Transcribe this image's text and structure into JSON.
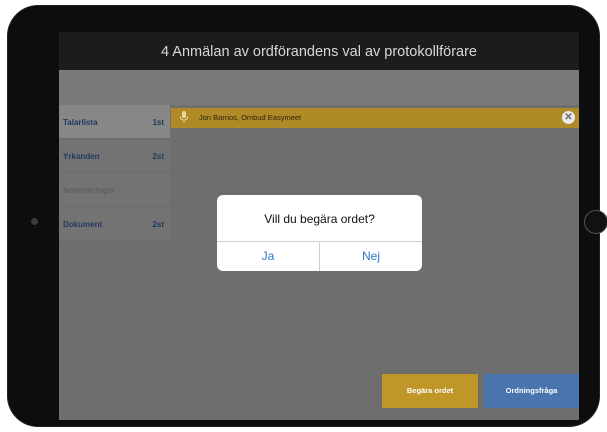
{
  "header": {
    "title": "4 Anmälan av ordförandens val av protokollförare"
  },
  "sidebar": {
    "items": [
      {
        "label": "Talarlista",
        "count": "1st"
      },
      {
        "label": "Yrkanden",
        "count": "2st"
      },
      {
        "label": "Nomineringar",
        "count": ""
      },
      {
        "label": "Dokument",
        "count": "2st"
      }
    ]
  },
  "speaker": {
    "name": "Jon Barrios, Ombud Easymeet",
    "icon": "microphone-icon",
    "close_icon": "close-icon"
  },
  "dialog": {
    "message": "Vill du begära ordet?",
    "yes": "Ja",
    "no": "Nej"
  },
  "actions": {
    "request": "Begära ordet",
    "order": "Ordningsfråga"
  },
  "colors": {
    "accent": "#bf9628",
    "secondary": "#4a74ae",
    "link": "#2a78c8"
  }
}
